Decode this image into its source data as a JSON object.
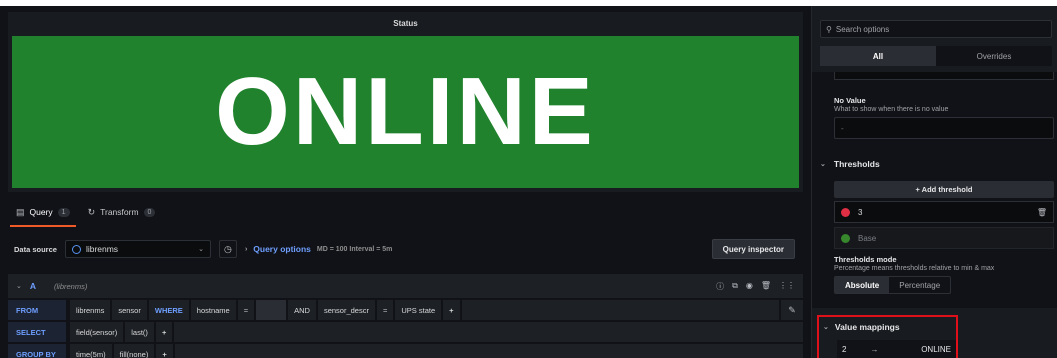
{
  "panel": {
    "title": "Status",
    "value": "ONLINE",
    "color": "#20822c"
  },
  "tabs": [
    {
      "label": "Query",
      "count": "1",
      "icon": "database-icon"
    },
    {
      "label": "Transform",
      "count": "0",
      "icon": "transform-icon"
    }
  ],
  "datasource": {
    "label": "Data source",
    "name": "librenms",
    "query_options_label": "Query options",
    "meta": "MD = 100   Interval = 5m",
    "inspector_label": "Query inspector"
  },
  "query": {
    "letter": "A",
    "datasource": "(librenms)",
    "from": {
      "keyword": "FROM",
      "db": "librenms",
      "measurement": "sensor",
      "where": "WHERE",
      "tag1": "hostname",
      "op1": "=",
      "and": "AND",
      "tag2": "sensor_descr",
      "op2": "=",
      "val2": "UPS state",
      "plus": "+"
    },
    "select": {
      "keyword": "SELECT",
      "field": "field(sensor)",
      "agg": "last()",
      "plus": "+"
    },
    "groupby": {
      "keyword": "GROUP BY",
      "time": "time(5m)",
      "fill": "fill(none)",
      "plus": "+"
    }
  },
  "options": {
    "search_placeholder": "Search options",
    "switch_all": "All",
    "switch_overrides": "Overrides",
    "no_value": {
      "label": "No Value",
      "desc": "What to show when there is no value",
      "placeholder": "-"
    },
    "thresholds": {
      "title": "Thresholds",
      "add_label": "+ Add threshold",
      "steps": [
        {
          "value": "3",
          "color": "#e02f44"
        },
        {
          "value": "Base",
          "color": "#37872d"
        }
      ],
      "mode_label": "Thresholds mode",
      "mode_desc": "Percentage means thresholds relative to min & max",
      "mode_absolute": "Absolute",
      "mode_percentage": "Percentage"
    },
    "value_mappings": {
      "title": "Value mappings",
      "from": "2",
      "arrow": "→",
      "to": "ONLINE"
    }
  }
}
